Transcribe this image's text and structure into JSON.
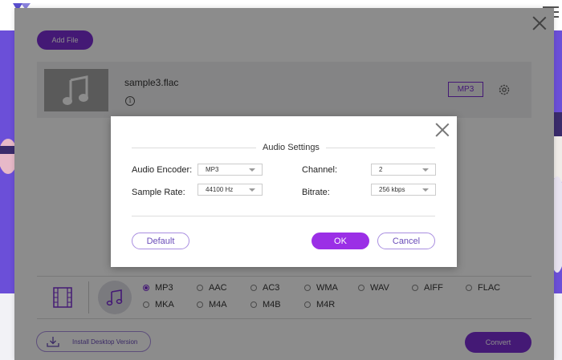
{
  "app": {
    "add_file_label": "Add File",
    "file": {
      "name": "sample3.flac",
      "format_chip": "MP3"
    },
    "formats": [
      {
        "label": "MP3",
        "selected": true
      },
      {
        "label": "AAC",
        "selected": false
      },
      {
        "label": "AC3",
        "selected": false
      },
      {
        "label": "WMA",
        "selected": false
      },
      {
        "label": "WAV",
        "selected": false
      },
      {
        "label": "AIFF",
        "selected": false
      },
      {
        "label": "FLAC",
        "selected": false
      },
      {
        "label": "MKA",
        "selected": false
      },
      {
        "label": "M4A",
        "selected": false
      },
      {
        "label": "M4B",
        "selected": false
      },
      {
        "label": "M4R",
        "selected": false
      }
    ],
    "install_label": "Install Desktop Version",
    "convert_label": "Convert",
    "accent_color": "#7d2fd6"
  },
  "dialog": {
    "title": "Audio Settings",
    "encoder": {
      "label": "Audio Encoder:",
      "value": "MP3"
    },
    "sample_rate": {
      "label": "Sample Rate:",
      "value": "44100 Hz"
    },
    "channel": {
      "label": "Channel:",
      "value": "2"
    },
    "bitrate": {
      "label": "Bitrate:",
      "value": "256 kbps"
    },
    "default_label": "Default",
    "ok_label": "OK",
    "cancel_label": "Cancel"
  }
}
